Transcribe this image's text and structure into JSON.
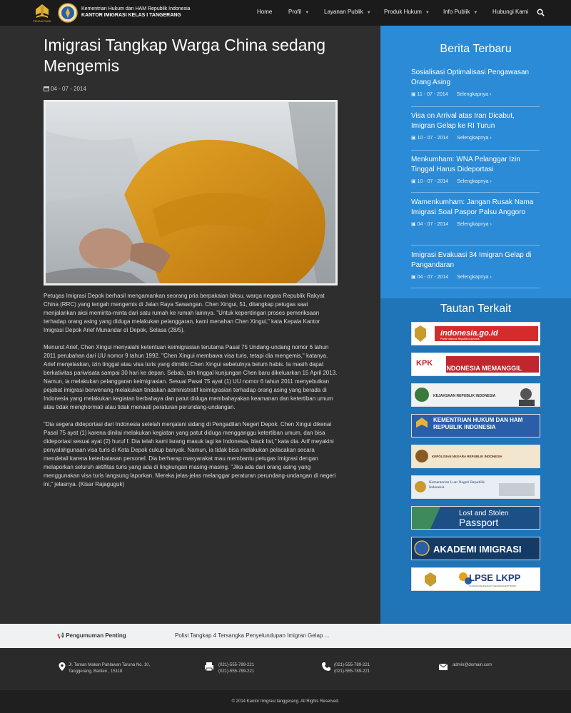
{
  "header": {
    "brand_line1": "Kementrian Hukum dan HAM Republik Indonesia",
    "brand_line2": "KANTOR IMIGRASI KELAS I TANGERANG",
    "logo1_caption": "PENGAYOMAN",
    "nav": [
      {
        "label": "Home",
        "caret": false
      },
      {
        "label": "Profil",
        "caret": true
      },
      {
        "label": "Layanan Publik",
        "caret": true
      },
      {
        "label": "Produk Hukum",
        "caret": true
      },
      {
        "label": "Info Publik",
        "caret": true
      },
      {
        "label": "Hubungi Kami",
        "caret": false
      }
    ]
  },
  "article": {
    "title": "Imigrasi Tangkap Warga China sedang Mengemis",
    "date": "04 - 07 - 2014",
    "paragraphs": [
      "Petugas Imigrasi Depok berhasil mengamankan seorang pria berpakaian biksu, warga negara Republik Rakyat China (RRC) yang tengah mengemis di Jalan Raya Sawangan. Chen Xingui, 51, ditangkap petugas saat menjalankan aksi meminta-minta dari satu rumah ke rumah lainnya. \"Untuk kepentingan proses pemeriksaan terhadap orang asing yang diduga melakukan pelanggaran, kami menahan Chen Xingui,\" kata Kepala Kantor Imigrasi Depok Arief Munandar di Depok, Selasa (28/5).",
      "Menurut Arief, Chen Xingui menyalahi ketentuan keimigrasian terutama Pasal 75 Undang-undang nomor 6 tahun 2011 perubahan dari UU nomor 9 tahun 1992. \"Chen Xingui membawa visa turis, tetapi dia mengemis,\" katanya. Arief menjelaskan, izin tinggal atau visa turis yang dimiliki Chen Xingui sebetulnya belum habis. Ia masih dapat berkativitas pariwisata sampai 30 hari ke depan. Sebab, izin tinggal kunjungan Chen baru dikeluarkan 15 April 2013.\nNamun, ia melakukan pelanggaran keimigrasian. Sesuai Pasal 75 ayat (1) UU nomor 6 tahun 2011 menyebutkan  pejabat imigrasi berwenang melakukan tindakan administratif keimigrasian terhadap orang asing yang berada di Indonesia yang melakukan kegiatan berbahaya dan patut diduga membahayakan keamanan dan ketertiban umum atau tidak menghormati atau tidak menaati peraturan perundang-undangan.",
      "\"Dia segera dideportasi dari Indonesia setelah menjalani sidang di Pengadilan Negeri Depok. Chen Xingui dikenai Pasal 75 ayat (1) karena dinilai melakukan kegiatan yang patut diduga mengganggu ketertiban umum, dan bisa dideportasi sesuai ayat (2) huruf f. Dia telah kami larang masuk lagi ke Indonesia, black list,\" kata dia. Arif meyakini penyalahgunaan visa turis di Kota Depok cukup banyak. Namun, ia tidak bisa melakukan pelacakan secara mendetail karena keterbatasan personel.  Dia berharap masyarakat mau membantu petugas Imigrasi dengan melaporkan seluruh aktifitas turis yang ada di lingkungan masing-masing. \"Jika ada dari orang asing yang menggunakan visa turis langsung laporkan. Mereka jelas-jelas melanggar peraturan perundang-undangan di negeri ini,\" jelasnya. (Kisar Rajaguguk)"
    ]
  },
  "sidebar": {
    "news_title": "Berita Terbaru",
    "more_label": "Selengkapnya ›",
    "news": [
      {
        "headline": "Sosialisasi Optimalisasi Pengawasan Orang Asing",
        "date": "11 - 07 - 2014"
      },
      {
        "headline": "Visa on Arrival atas Iran Dicabut, Imigran Gelap ke RI Turun",
        "date": "10 - 07 - 2014"
      },
      {
        "headline": "Menkumham: WNA Pelanggar Izin Tinggal Harus Dideportasi",
        "date": "10 - 07 - 2014"
      },
      {
        "headline": "Wamenkumham: Jangan Rusak Nama Imigrasi Soal Paspor Palsu Anggoro",
        "date": "04 - 07 - 2014"
      },
      {
        "headline": "Imigrasi Evakuasi 34 Imigran Gelap di Pangandaran",
        "date": "04 - 07 - 2014"
      }
    ],
    "links_title": "Tautan Terkait",
    "links": [
      {
        "text": "indonesia.go.id",
        "sub": "Portal Nasional Republik Indonesia"
      },
      {
        "text": "KPK",
        "sub": "INDONESIA MEMANGGIL"
      },
      {
        "text": "KEJAKSAAN REPUBLIK INDONESIA",
        "sub": ""
      },
      {
        "text": "KEMENTRIAN HUKUM DAN HAM REPUBLIK INDONESIA",
        "sub": ""
      },
      {
        "text": "KEPOLISIAN NEGARA REPUBLIK INDONESIA",
        "sub": ""
      },
      {
        "text": "Kementerian Luar Negeri Republik Indonesia",
        "sub": ""
      },
      {
        "text": "Lost and Stolen",
        "sub": "Passport"
      },
      {
        "text": "AKADEMI IMIGRASI",
        "sub": ""
      },
      {
        "text": "LPSE LKPP",
        "sub": "LAYANAN PENGADAAN SECARA ELEKTRONIK"
      }
    ]
  },
  "announcement": {
    "label": "Pengumuman Penting",
    "text": "Polisi Tangkap 4 Tersangka Penyelundupan Imigran Gelap ..."
  },
  "footer": {
    "address_1": "Jl. Taman Makan Pahlawan Taruna No. 10,",
    "address_2": "Tanggerang, Banten , 15118",
    "fax_1": "(021)-555-789-221",
    "fax_2": "(021)-555-789-221",
    "phone_1": "(021)-555-789-221",
    "phone_2": "(021)-555-789-221",
    "email": "admin@domain.com",
    "copyright": "© 2014 Kantor Imigrasi tanggerang. All Rights Reserved."
  },
  "colors": {
    "sidebar_news_bg": "#2b8bd6",
    "sidebar_links_bg": "#1f75b8",
    "page_bg": "#2e2e2e"
  }
}
